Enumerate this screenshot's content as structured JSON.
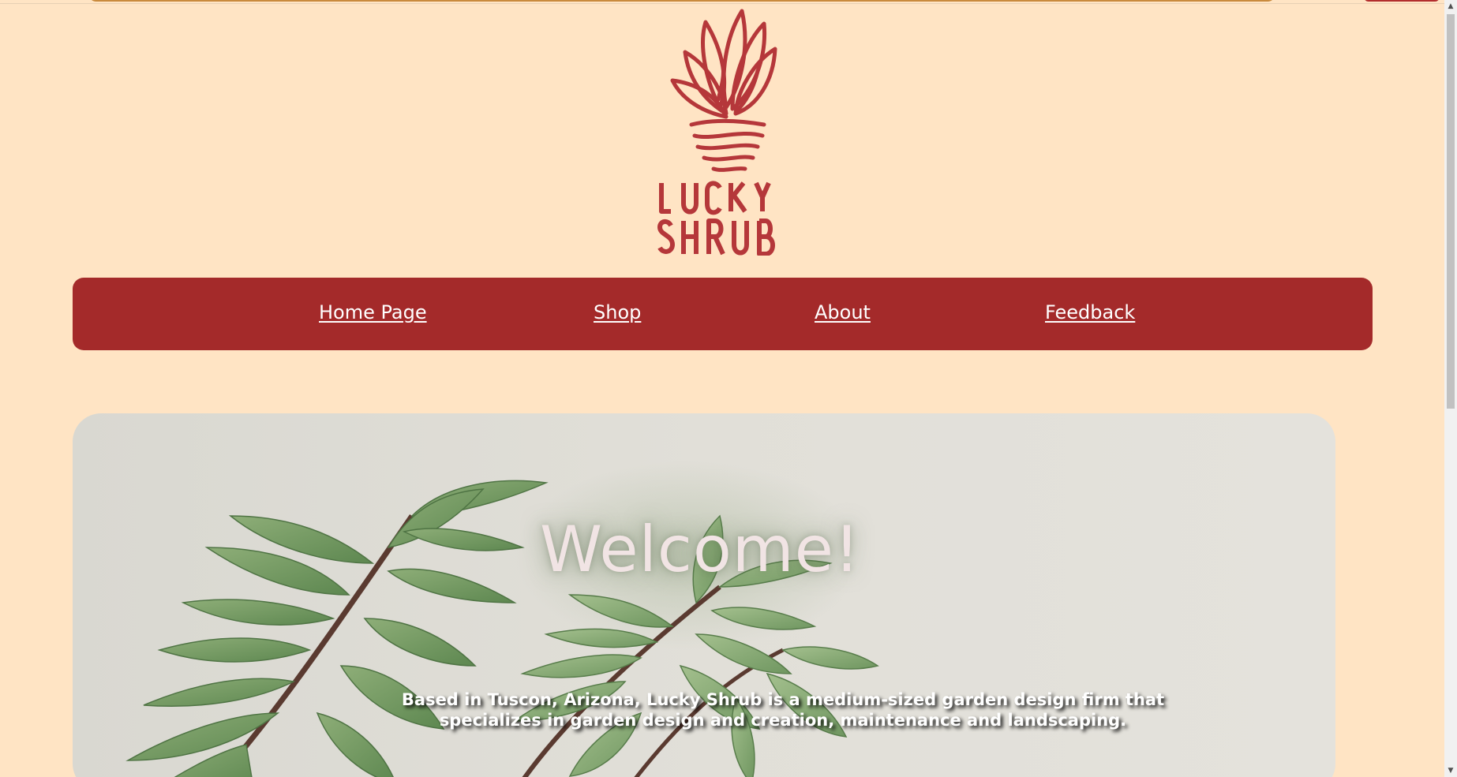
{
  "brand": {
    "name": "Lucky Shrub",
    "logo_text_line1": "LUCKY",
    "logo_text_line2": "SHRUB",
    "color": "#b5373a"
  },
  "nav": {
    "background": "#a42a2a",
    "items": [
      {
        "label": "Home Page"
      },
      {
        "label": "Shop"
      },
      {
        "label": "About"
      },
      {
        "label": "Feedback"
      }
    ]
  },
  "hero": {
    "heading": "Welcome!",
    "tagline": "Based in Tuscon, Arizona, Lucky Shrub is a medium-sized garden design firm that specializes in garden design and creation, maintenance and landscaping."
  },
  "scrollbar": {
    "up_icon": "▲",
    "down_icon": "▼"
  },
  "colors": {
    "page_background": "#ffe4c4",
    "nav_text": "#ffffff"
  }
}
